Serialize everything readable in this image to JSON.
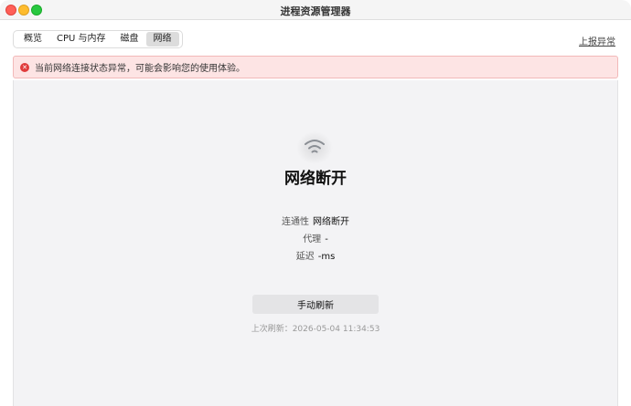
{
  "window": {
    "title": "进程资源管理器"
  },
  "tabs": [
    {
      "label": "概览",
      "active": false
    },
    {
      "label": "CPU 与内存",
      "active": false
    },
    {
      "label": "磁盘",
      "active": false
    },
    {
      "label": "网络",
      "active": true
    }
  ],
  "header": {
    "report_label": "上报异常"
  },
  "alert": {
    "icon": "error-circle-icon",
    "text": "当前网络连接状态异常，可能会影响您的使用体验。",
    "color": "#e03c3c"
  },
  "network": {
    "icon": "wifi-icon",
    "status_title": "网络断开",
    "rows": [
      {
        "label": "连通性",
        "value": "网络断开"
      },
      {
        "label": "代理",
        "value": "-"
      },
      {
        "label": "延迟",
        "value": "-ms"
      }
    ],
    "refresh_button": "手动刷新",
    "last_refresh": "上次刷新：2026-05-04 11:34:53"
  }
}
